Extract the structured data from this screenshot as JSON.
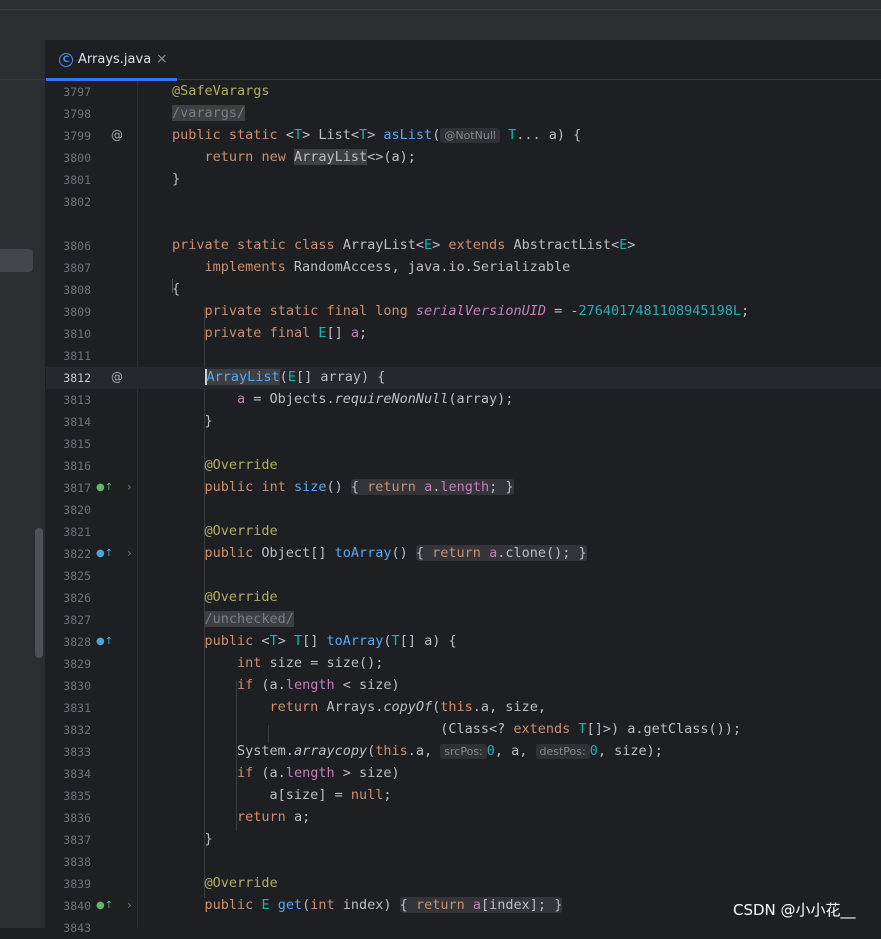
{
  "tab": {
    "label": "Arrays.java",
    "close": "×",
    "icon": "C"
  },
  "gutter_marks": {
    "at": "@",
    "override_up": "●↑",
    "chevron": "›"
  },
  "lines": [
    {
      "n": "3797"
    },
    {
      "n": "3798"
    },
    {
      "n": "3799"
    },
    {
      "n": "3800"
    },
    {
      "n": "3801"
    },
    {
      "n": "3802"
    },
    {
      "n": ""
    },
    {
      "n": "3806"
    },
    {
      "n": "3807"
    },
    {
      "n": "3808"
    },
    {
      "n": "3809"
    },
    {
      "n": "3810"
    },
    {
      "n": "3811"
    },
    {
      "n": "3812"
    },
    {
      "n": "3813"
    },
    {
      "n": "3814"
    },
    {
      "n": "3815"
    },
    {
      "n": "3816"
    },
    {
      "n": "3817"
    },
    {
      "n": "3820"
    },
    {
      "n": "3821"
    },
    {
      "n": "3822"
    },
    {
      "n": "3825"
    },
    {
      "n": "3826"
    },
    {
      "n": "3827"
    },
    {
      "n": "3828"
    },
    {
      "n": "3829"
    },
    {
      "n": "3830"
    },
    {
      "n": "3831"
    },
    {
      "n": "3832"
    },
    {
      "n": "3833"
    },
    {
      "n": "3834"
    },
    {
      "n": "3835"
    },
    {
      "n": "3836"
    },
    {
      "n": "3837"
    },
    {
      "n": "3838"
    },
    {
      "n": "3839"
    },
    {
      "n": "3840"
    },
    {
      "n": "3843"
    }
  ],
  "code": {
    "safevarargs": "@SafeVarargs",
    "varargs_comment": "/varargs/",
    "public": "public",
    "static": "static",
    "private": "private",
    "class": "class",
    "final": "final",
    "long": "long",
    "int": "int",
    "return": "return",
    "new": "new",
    "implements": "implements",
    "extends": "extends",
    "if": "if",
    "this": "this",
    "null": "null",
    "T": "T",
    "E": "E",
    "aslist_pre": " <",
    "aslist_mid": "> List<",
    "aslist_fn": "asList",
    "notnull_hint": "@NotNull",
    "aslist_tail": "... a) {",
    "arraylist": "ArrayList",
    "arraylist_args": "<>(a);",
    "close_brace": "}",
    "open_brace": "{",
    "decl_class_tail": " ArrayList<",
    "abstractlist": " AbstractList<",
    "gt": ">",
    "implements_tail": " RandomAccess, java.io.Serializable",
    "serial_name": "serialVersionUID",
    "serial_eq": " = -",
    "serial_value": "2764017481108945198L",
    "semi": ";",
    "e_array": "[] ",
    "field_a": "a",
    "ctor_args": "[] array) {",
    "objects_pre": " = Objects.",
    "require_nonnull": "requireNonNull",
    "array_close": "(array);",
    "override": "@Override",
    "size_fn": "size",
    "size_fold": "() ",
    "length": "length",
    "object_arr": " Object[] ",
    "toarray_fn": "toArray",
    "clone_call": ".clone();",
    "unchecked_comment": "/unchecked/",
    "toarray_sig_mid": "[] ",
    "toarray_args_open": "(",
    "toarray_args_close": "[] a) {",
    "int_size": " size = size();",
    "if_open": " (a.",
    "lt_size": " < size)",
    "gt_size": " > size)",
    "arrays_pre": " Arrays.",
    "copyof_fn": "copyOf",
    "copyof_tail": ".a, size,",
    "class_cast_pre": "(Class<? ",
    "class_cast_tail": "[]>) a.getClass());",
    "system_pre": "System.",
    "arraycopy_fn": "arraycopy",
    "arraycopy_this": "(",
    "arraycopy_a": ".a, ",
    "srcpos_hint": "srcPos:",
    "zero": "0",
    "mid_a": ", a, ",
    "destpos_hint": "destPos:",
    "arraycopy_tail": ", size);",
    "asize_assign": "a[size] = ",
    "return_a": " a;",
    "get_fn": "get",
    "get_args_open": "(",
    "get_args_close": " index) ",
    "index_tail": "[index];"
  },
  "watermark": "CSDN @小小花__"
}
